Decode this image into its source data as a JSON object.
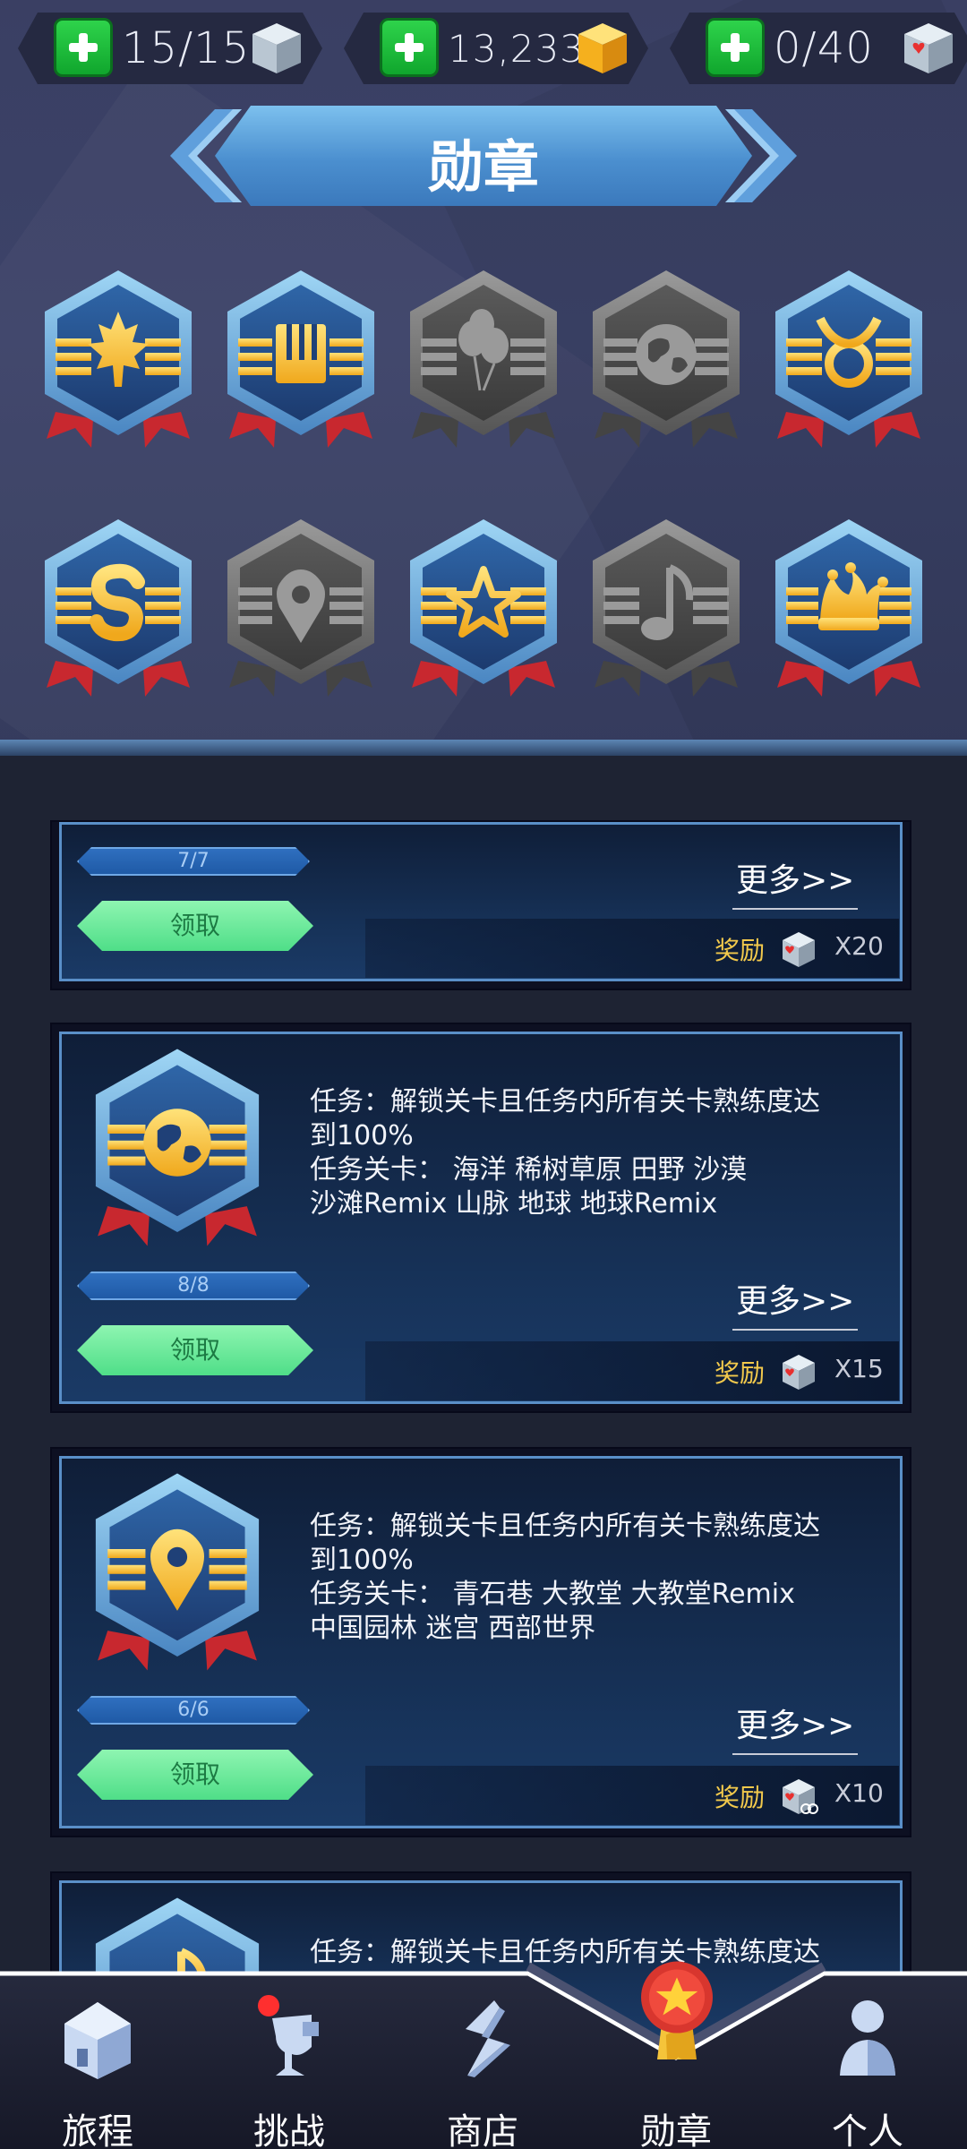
{
  "resources": {
    "lives": "15/15",
    "coins": "13,233",
    "hearts": "0/40"
  },
  "page_title": "勋章",
  "medals_row1": [
    "maple-leaf",
    "piano",
    "balloons",
    "earth",
    "taurus"
  ],
  "medals_row2": [
    "letter-s",
    "location-pin",
    "star",
    "music-note",
    "jester-hat"
  ],
  "medals_locked": [
    false,
    false,
    true,
    true,
    false,
    false,
    true,
    false,
    true,
    false
  ],
  "tasks": [
    {
      "progress": "7/7",
      "claim_label": "领取",
      "more_label": "更多>>",
      "reward_label": "奖励",
      "reward_value": "X20"
    },
    {
      "line1": "任务：解锁关卡且任务内所有关卡熟练度达",
      "line2": "到100%",
      "line3": "任务关卡： 海洋 稀树草原 田野 沙漠",
      "line4": "沙滩Remix 山脉 地球 地球Remix",
      "progress": "8/8",
      "claim_label": "领取",
      "more_label": "更多>>",
      "reward_label": "奖励",
      "reward_value": "X15"
    },
    {
      "line1": "任务：解锁关卡且任务内所有关卡熟练度达",
      "line2": "到100%",
      "line3": "任务关卡： 青石巷 大教堂 大教堂Remix",
      "line4": "中国园林 迷宫 西部世界",
      "progress": "6/6",
      "claim_label": "领取",
      "more_label": "更多>>",
      "reward_label": "奖励",
      "reward_value": "X10"
    },
    {
      "line1": "任务：解锁关卡且任务内所有关卡熟练度达"
    }
  ],
  "nav": [
    {
      "label": "旅程",
      "icon": "house-icon"
    },
    {
      "label": "挑战",
      "icon": "trophy-icon"
    },
    {
      "label": "商店",
      "icon": "shop-s-icon"
    },
    {
      "label": "勋章",
      "icon": "medal-icon"
    },
    {
      "label": "个人",
      "icon": "person-icon"
    }
  ],
  "colors": {
    "header_bg": "#3c4369",
    "list_bg": "#1e2333",
    "claim_green": "#4fde88",
    "medal_gold": "#f5c43a",
    "medal_blue": "#2d5a9c",
    "reward_yellow": "#f2c94c"
  }
}
